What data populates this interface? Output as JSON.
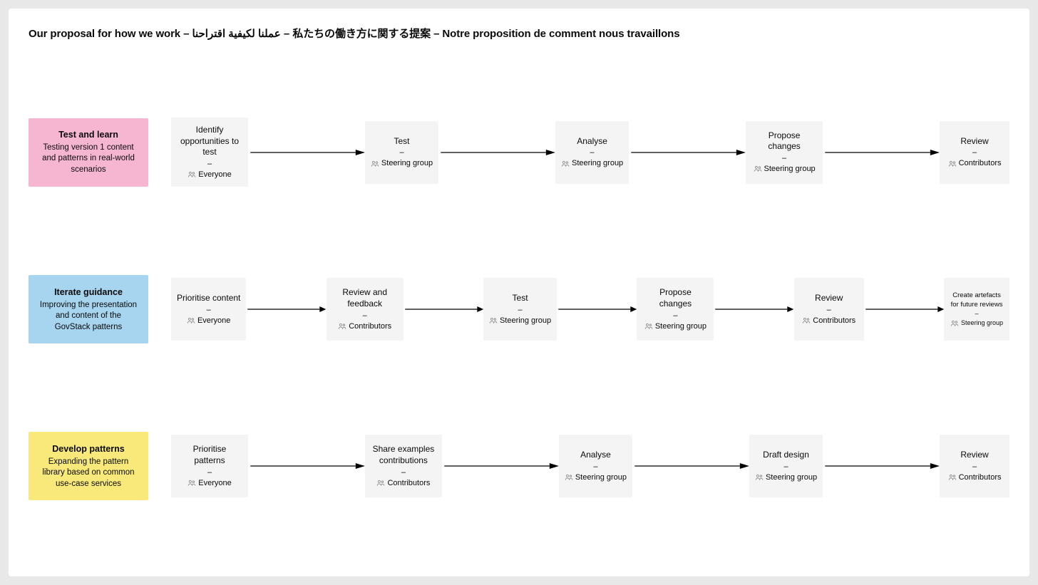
{
  "title": "Our proposal for how we work – عملنا لكيفية اقتراحنا – 私たちの働き方に関する提案 – Notre proposition de comment nous travaillons",
  "rows": [
    {
      "color": "pink",
      "swim_title": "Test and learn",
      "swim_desc": "Testing version 1 content and patterns in real-world scenarios",
      "steps": [
        {
          "title": "Identify opportunities to test",
          "who": "Everyone"
        },
        {
          "title": "Test",
          "who": "Steering group"
        },
        {
          "title": "Analyse",
          "who": "Steering group"
        },
        {
          "title": "Propose changes",
          "who": "Steering group"
        },
        {
          "title": "Review",
          "who": "Contributors"
        }
      ]
    },
    {
      "color": "blue",
      "swim_title": "Iterate guidance",
      "swim_desc": "Improving the presentation and content of the GovStack patterns",
      "steps": [
        {
          "title": "Prioritise content",
          "who": "Everyone"
        },
        {
          "title": "Review and feedback",
          "who": "Contributors"
        },
        {
          "title": "Test",
          "who": "Steering group"
        },
        {
          "title": "Propose changes",
          "who": "Steering group"
        },
        {
          "title": "Review",
          "who": "Contributors"
        },
        {
          "title": "Create artefacts for future reviews",
          "who": "Steering group",
          "small": true
        }
      ]
    },
    {
      "color": "yellow",
      "swim_title": "Develop patterns",
      "swim_desc": "Expanding the pattern library based on common use-case services",
      "steps": [
        {
          "title": "Prioritise patterns",
          "who": "Everyone"
        },
        {
          "title": "Share examples contributions",
          "who": "Contributors"
        },
        {
          "title": "Analyse",
          "who": "Steering group"
        },
        {
          "title": "Draft design",
          "who": "Steering group"
        },
        {
          "title": "Review",
          "who": "Contributors"
        }
      ]
    }
  ]
}
